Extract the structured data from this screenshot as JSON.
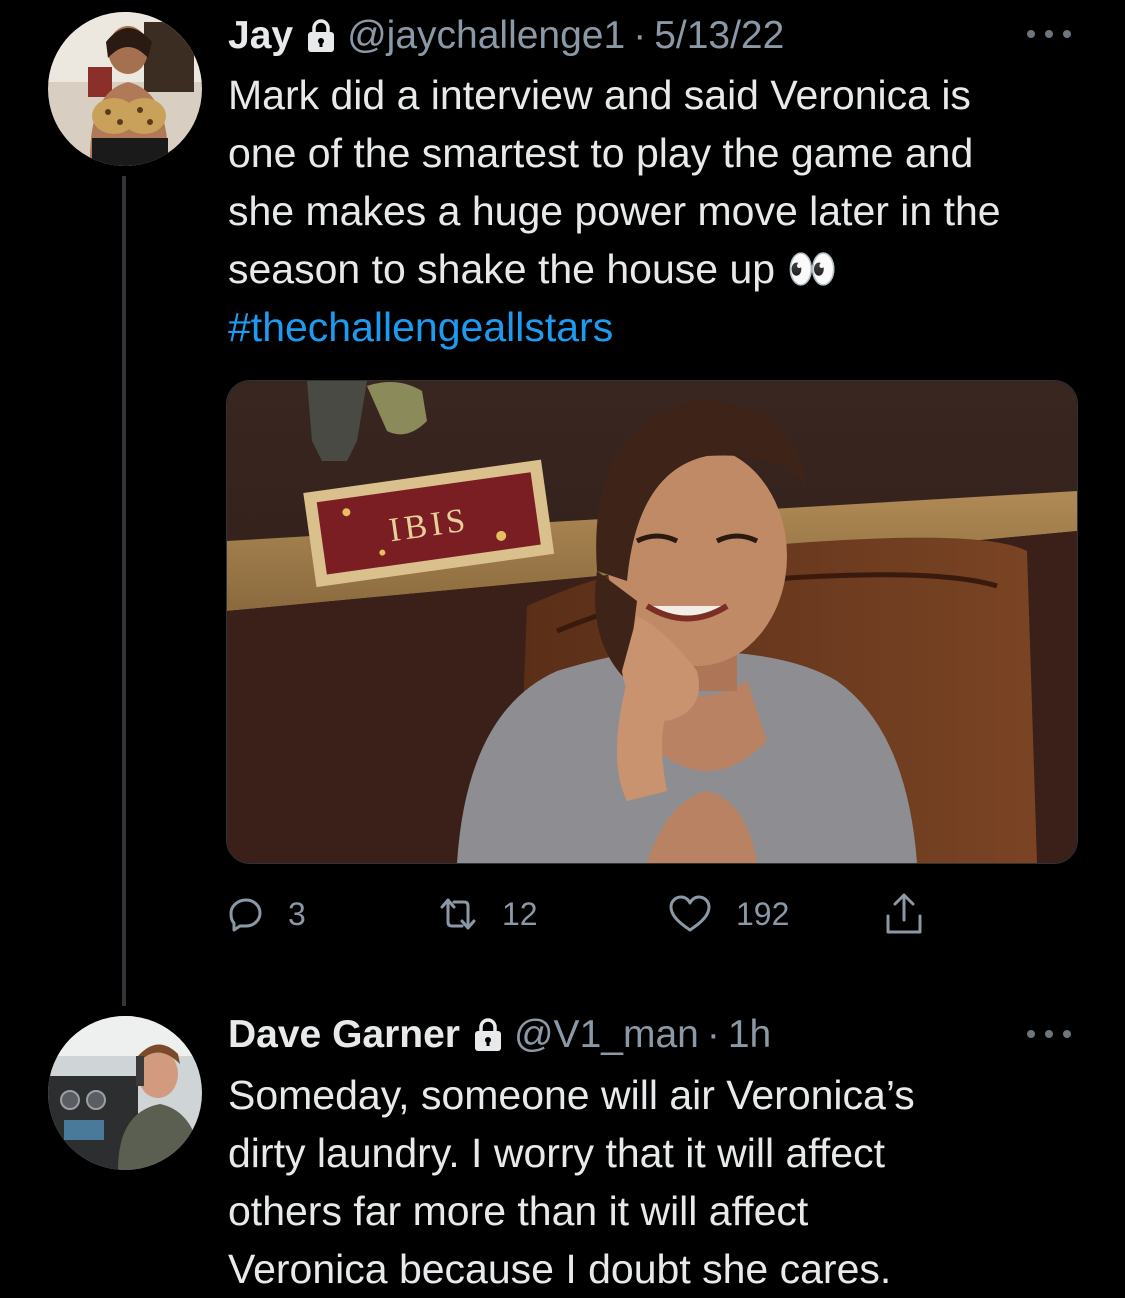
{
  "tweets": [
    {
      "name": "Jay",
      "handle": "@jaychallenge1",
      "separator": "·",
      "time": "5/13/22",
      "text": "Mark did a interview and said Veronica is\none of the smartest to play the game and\nshe makes a huge power move later in the\nseason to shake the house up 👀",
      "hashtag": "#thechallengeallstars",
      "media": {
        "sign_text": "IBIS"
      },
      "actions": {
        "replies": "3",
        "retweets": "12",
        "likes": "192"
      }
    },
    {
      "name": "Dave Garner",
      "handle": "@V1_man",
      "separator": "·",
      "time": "1h",
      "text": "Someday, someone will air Veronica’s\ndirty laundry. I worry that it will affect\nothers far more than it will affect\nVeronica because I doubt she cares."
    }
  ],
  "icons": {
    "lock": "lock-icon",
    "more": "more-icon",
    "reply": "reply-icon",
    "retweet": "retweet-icon",
    "like": "heart-icon",
    "share": "share-icon"
  },
  "colors": {
    "background": "#000000",
    "text": "#e7e9ea",
    "secondary": "#8b98a5",
    "link": "#1d9bf0"
  }
}
